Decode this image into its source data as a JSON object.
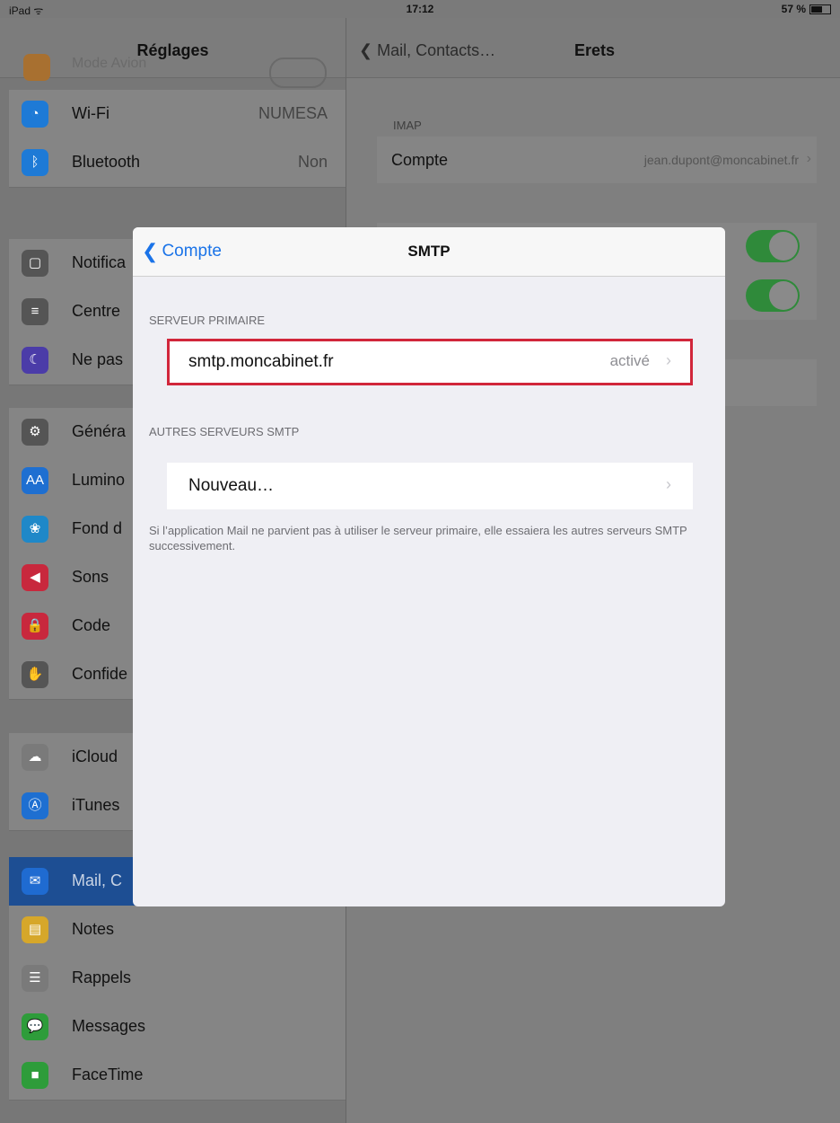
{
  "statusbar": {
    "device": "iPad ᯤ",
    "time": "17:12",
    "battery": "57 %"
  },
  "left": {
    "title": "Réglages",
    "peek_label": "Mode Avion",
    "items": [
      {
        "label": "Wi-Fi",
        "value": "NUMESA",
        "icon": "wifi-icon",
        "color": "#1e7ad6",
        "glyph": "◔"
      },
      {
        "label": "Bluetooth",
        "value": "Non",
        "icon": "bluetooth-icon",
        "color": "#1e7ad6",
        "glyph": "ᛒ"
      },
      {
        "label": "Notifica",
        "value": "",
        "icon": "notifications-icon",
        "color": "#555",
        "glyph": "▢"
      },
      {
        "label": "Centre",
        "value": "",
        "icon": "control-center-icon",
        "color": "#555",
        "glyph": "≡"
      },
      {
        "label": "Ne pas",
        "value": "",
        "icon": "do-not-disturb-icon",
        "color": "#4b3ca8",
        "glyph": "☾"
      },
      {
        "label": "Généra",
        "value": "",
        "icon": "general-gear-icon",
        "color": "#555",
        "glyph": "⚙"
      },
      {
        "label": "Lumino",
        "value": "",
        "icon": "brightness-icon",
        "color": "#1e6fd1",
        "glyph": "AA"
      },
      {
        "label": "Fond d",
        "value": "",
        "icon": "wallpaper-icon",
        "color": "#1f88c8",
        "glyph": "❀"
      },
      {
        "label": "Sons",
        "value": "",
        "icon": "sounds-icon",
        "color": "#c8283d",
        "glyph": "◀"
      },
      {
        "label": "Code",
        "value": "",
        "icon": "passcode-lock-icon",
        "color": "#c8283d",
        "glyph": "🔒"
      },
      {
        "label": "Confide",
        "value": "",
        "icon": "privacy-hand-icon",
        "color": "#555",
        "glyph": "✋"
      },
      {
        "label": "iCloud",
        "value": "",
        "icon": "icloud-icon",
        "color": "#7a7a7a",
        "glyph": "☁"
      },
      {
        "label": "iTunes",
        "value": "",
        "icon": "itunes-store-icon",
        "color": "#1e6fd1",
        "glyph": "Ⓐ"
      },
      {
        "label": "Mail, C",
        "value": "",
        "icon": "mail-icon",
        "color": "#1f6bd1",
        "glyph": "✉"
      },
      {
        "label": "Notes",
        "value": "",
        "icon": "notes-icon",
        "color": "#d6a72a",
        "glyph": "▤"
      },
      {
        "label": "Rappels",
        "value": "",
        "icon": "reminders-icon",
        "color": "#7a7a7a",
        "glyph": "☰"
      },
      {
        "label": "Messages",
        "value": "",
        "icon": "messages-icon",
        "color": "#2e9c3a",
        "glyph": "💬"
      },
      {
        "label": "FaceTime",
        "value": "",
        "icon": "facetime-icon",
        "color": "#2e9c3a",
        "glyph": "■"
      }
    ]
  },
  "right": {
    "back_label": "Mail, Contacts…",
    "title": "Erets",
    "section": "IMAP",
    "account_label": "Compte",
    "account_value": "jean.dupont@moncabinet.fr"
  },
  "modal": {
    "back_label": "Compte",
    "title": "SMTP",
    "primary_header": "SERVEUR PRIMAIRE",
    "primary_server": "smtp.moncabinet.fr",
    "primary_status": "activé",
    "other_header": "AUTRES SERVEURS SMTP",
    "new_label": "Nouveau…",
    "footnote": "Si l’application Mail ne parvient pas à utiliser le serveur primaire, elle essaiera les autres serveurs SMTP successivement."
  }
}
